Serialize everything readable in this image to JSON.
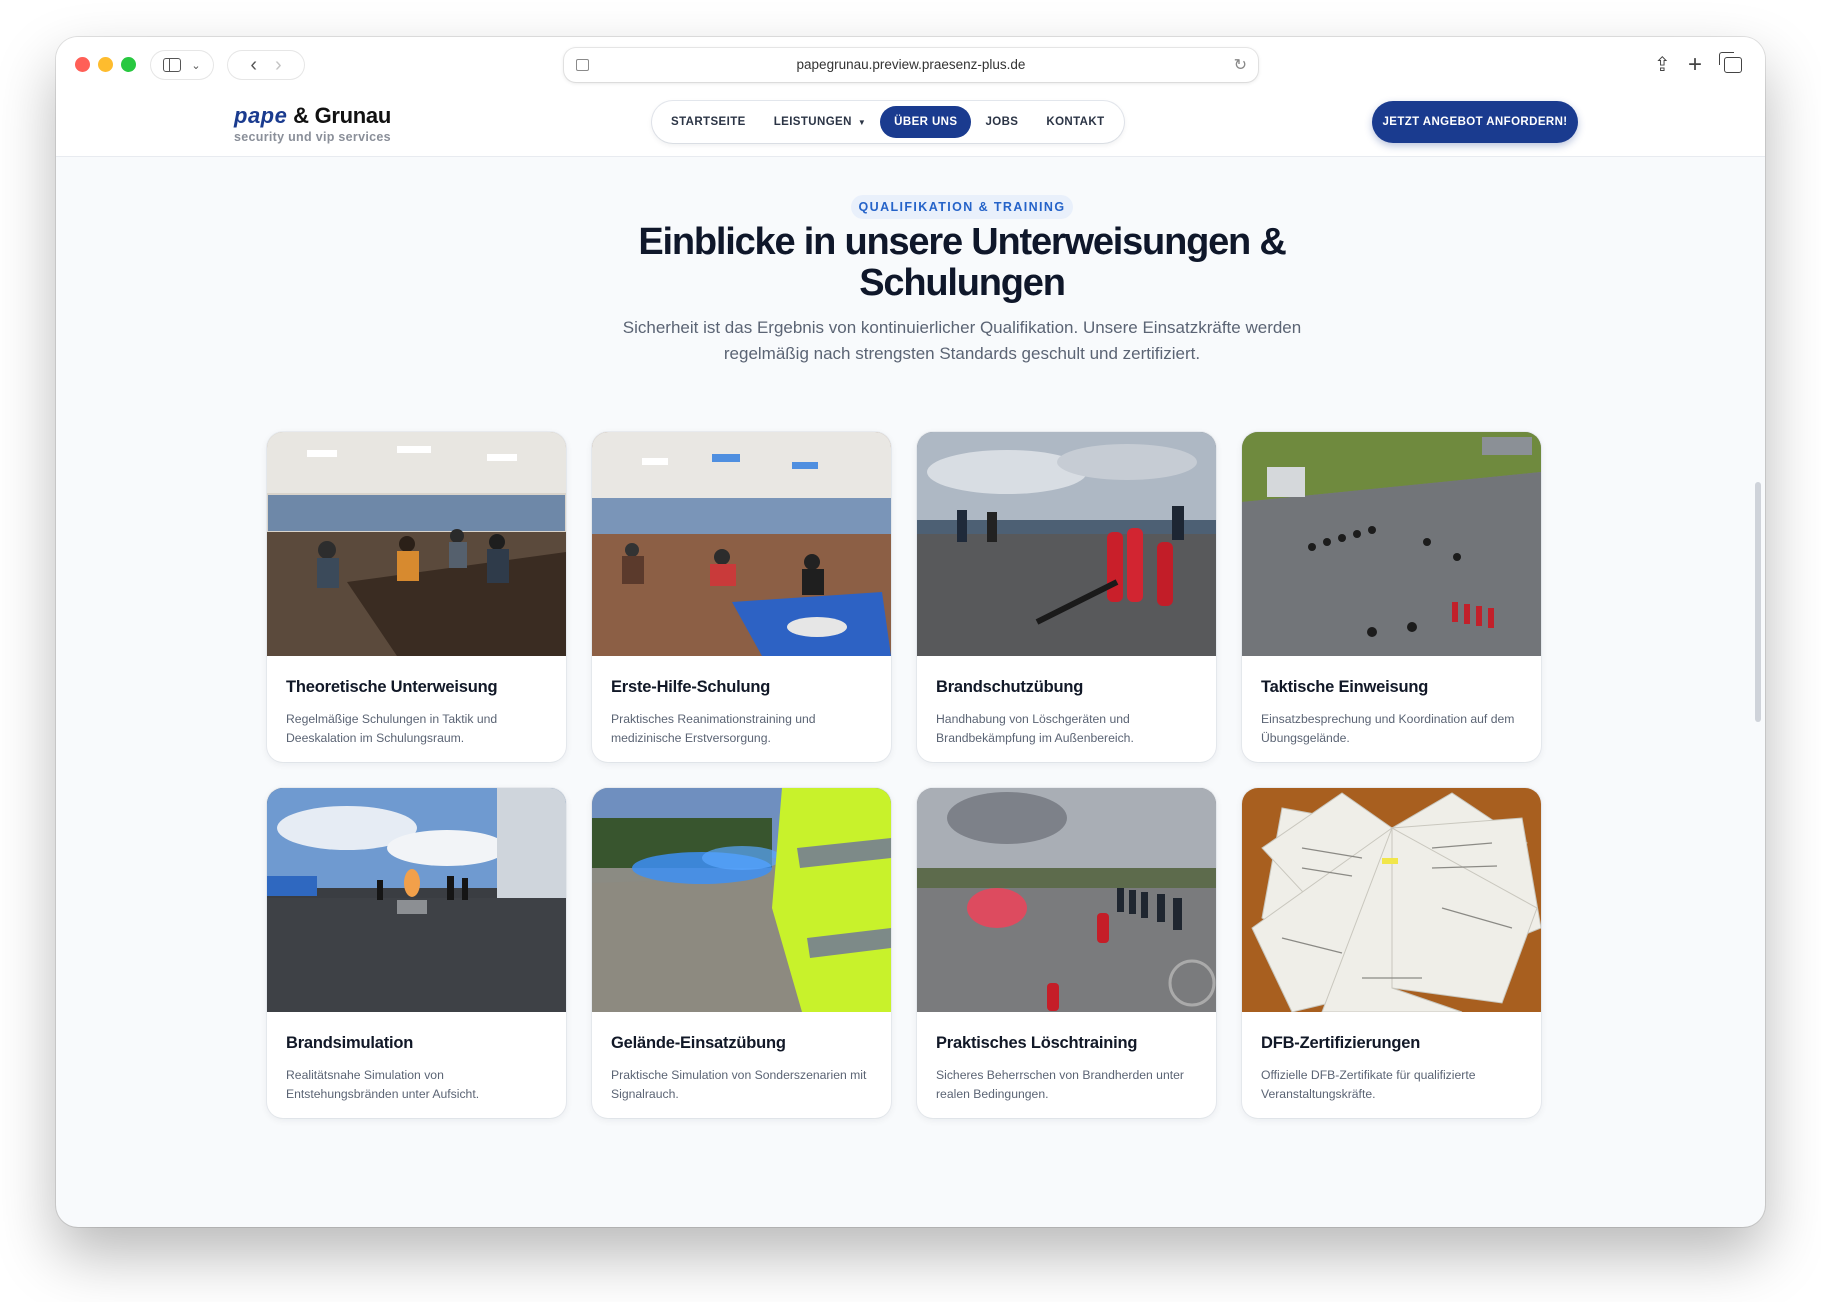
{
  "browser": {
    "url": "papegrunau.preview.praesenz-plus.de"
  },
  "header": {
    "logo_brand": "pape",
    "logo_rest": " & Grunau",
    "logo_tagline": "security und vip services",
    "nav": [
      {
        "label": "STARTSEITE",
        "active": false,
        "dropdown": false
      },
      {
        "label": "LEISTUNGEN",
        "active": false,
        "dropdown": true
      },
      {
        "label": "ÜBER UNS",
        "active": true,
        "dropdown": false
      },
      {
        "label": "JOBS",
        "active": false,
        "dropdown": false
      },
      {
        "label": "KONTAKT",
        "active": false,
        "dropdown": false
      }
    ],
    "cta_label": "JETZT ANGEBOT ANFORDERN!"
  },
  "section": {
    "eyebrow": "QUALIFIKATION & TRAINING",
    "title": "Einblicke in unsere Unterweisungen & Schulungen",
    "subtitle": "Sicherheit ist das Ergebnis von kontinuierlicher Qualifikation. Unsere Einsatzkräfte werden regelmäßig nach strengsten Standards geschult und zertifiziert."
  },
  "cards": [
    {
      "title": "Theoretische Unterweisung",
      "text": "Regelmäßige Schulungen in Taktik und Deeskalation im Schulungsraum."
    },
    {
      "title": "Erste-Hilfe-Schulung",
      "text": "Praktisches Reanimationstraining und medizinische Erstversorgung."
    },
    {
      "title": "Brandschutzübung",
      "text": "Handhabung von Löschgeräten und Brandbekämpfung im Außenbereich."
    },
    {
      "title": "Taktische Einweisung",
      "text": "Einsatzbesprechung und Koordination auf dem Übungsgelände."
    },
    {
      "title": "Brandsimulation",
      "text": "Realitätsnahe Simulation von Entstehungsbränden unter Aufsicht."
    },
    {
      "title": "Gelände-Einsatzübung",
      "text": "Praktische Simulation von Sonderszenarien mit Signalrauch."
    },
    {
      "title": "Praktisches Löschtraining",
      "text": "Sicheres Beherrschen von Brandherden unter realen Bedingungen."
    },
    {
      "title": "DFB-Zertifizierungen",
      "text": "Offizielle DFB-Zertifikate für qualifizierte Veranstaltungskräfte."
    }
  ],
  "colors": {
    "brand": "#1a3b8f",
    "accent": "#2563c9",
    "page_bg": "#f8fafc"
  }
}
